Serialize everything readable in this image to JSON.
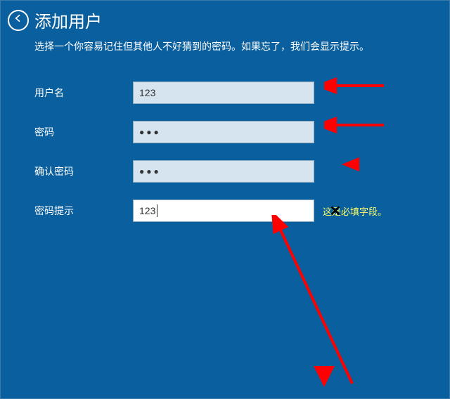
{
  "header": {
    "title": "添加用户",
    "subtitle": "选择一个你容易记住但其他人不好猜到的密码。如果忘了，我们会显示提示。"
  },
  "form": {
    "username": {
      "label": "用户名",
      "value": "123"
    },
    "password": {
      "label": "密码",
      "value": "●●●"
    },
    "confirm": {
      "label": "确认密码",
      "value": "●●●"
    },
    "hint": {
      "label": "密码提示",
      "value": "123",
      "required_msg": "这是必填字段。"
    }
  },
  "colors": {
    "bg": "#0a5f9e",
    "field_bg": "#d6e4ef",
    "hint": "#ffff66",
    "arrow": "#ff0000"
  }
}
